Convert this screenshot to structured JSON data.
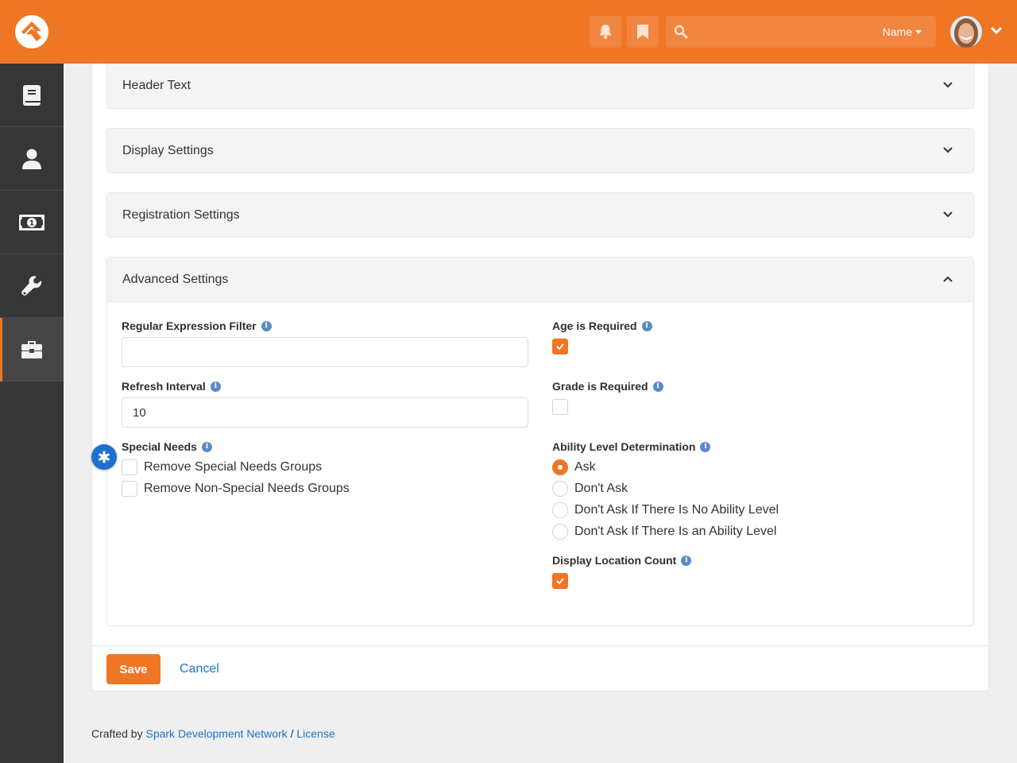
{
  "colors": {
    "brand": "#ee7625",
    "sidebar": "#363636",
    "link": "#1f74c4",
    "info": "#5b8bc6",
    "marker": "#1e6fce"
  },
  "topbar": {
    "logo_icon": "rock-logo-icon",
    "notifications_icon": "bell-icon",
    "bookmarks_icon": "bookmark-icon",
    "search": {
      "placeholder": "",
      "value": "",
      "icon": "search-icon",
      "filter_label": "Name"
    },
    "user_menu_icon": "chevron-down-icon"
  },
  "sidebar": {
    "items": [
      {
        "icon": "book-icon",
        "label": "Content",
        "active": false
      },
      {
        "icon": "user-icon",
        "label": "People",
        "active": false
      },
      {
        "icon": "money-icon",
        "label": "Finance",
        "active": false
      },
      {
        "icon": "wrench-icon",
        "label": "Tools",
        "active": false
      },
      {
        "icon": "briefcase-icon",
        "label": "Admin",
        "active": true
      }
    ]
  },
  "panels": [
    {
      "title": "Header Text",
      "expanded": false
    },
    {
      "title": "Display Settings",
      "expanded": false
    },
    {
      "title": "Registration Settings",
      "expanded": false
    },
    {
      "title": "Advanced Settings",
      "expanded": true
    }
  ],
  "advanced": {
    "regex_filter": {
      "label": "Regular Expression Filter",
      "value": "",
      "placeholder": ""
    },
    "refresh_interval": {
      "label": "Refresh Interval",
      "value": "10"
    },
    "special_needs": {
      "label": "Special Needs",
      "options": [
        {
          "label": "Remove Special Needs Groups",
          "checked": false
        },
        {
          "label": "Remove Non-Special Needs Groups",
          "checked": false
        }
      ]
    },
    "age_required": {
      "label": "Age is Required",
      "checked": true
    },
    "grade_required": {
      "label": "Grade is Required",
      "checked": false
    },
    "ability_level": {
      "label": "Ability Level Determination",
      "options": [
        {
          "label": "Ask",
          "selected": true
        },
        {
          "label": "Don't Ask",
          "selected": false
        },
        {
          "label": "Don't Ask If There Is No Ability Level",
          "selected": false
        },
        {
          "label": "Don't Ask If There Is an Ability Level",
          "selected": false
        }
      ]
    },
    "display_location_count": {
      "label": "Display Location Count",
      "checked": true
    }
  },
  "actions": {
    "save_label": "Save",
    "cancel_label": "Cancel"
  },
  "footer": {
    "crafted_by": "Crafted by",
    "org_link": "Spark Development Network",
    "separator": "/",
    "license_link": "License"
  }
}
